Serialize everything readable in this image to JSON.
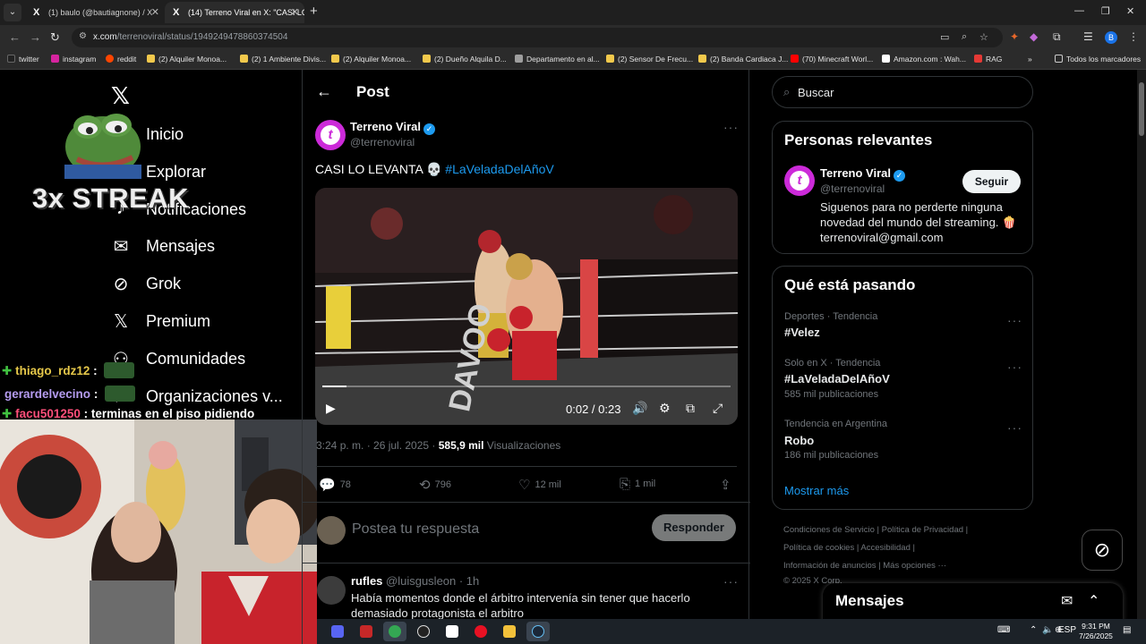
{
  "browser": {
    "tabs": [
      {
        "title": "(1) baulo (@bautiagnone) / X",
        "active": false
      },
      {
        "title": "(14) Terreno Viral en X: \"CASI LO",
        "active": true
      }
    ],
    "url_host": "x.com",
    "url_path": "/terrenoviral/status/1949249478860374504",
    "bookmarks": [
      {
        "label": "twitter",
        "color": "#000000"
      },
      {
        "label": "instagram",
        "color": "#d6249f"
      },
      {
        "label": "reddit",
        "color": "#ff4500"
      },
      {
        "label": "(2) Alquiler Monoa...",
        "color": "#f2c94c"
      },
      {
        "label": "(2) 1 Ambiente Divis...",
        "color": "#f2c94c"
      },
      {
        "label": "(2) Alquiler Monoa...",
        "color": "#f2c94c"
      },
      {
        "label": "(2) Dueño Alquila D...",
        "color": "#f2c94c"
      },
      {
        "label": "Departamento en al...",
        "color": "#9e9e9e"
      },
      {
        "label": "(2) Sensor De Frecu...",
        "color": "#f2c94c"
      },
      {
        "label": "(2) Banda Cardiaca J...",
        "color": "#f2c94c"
      },
      {
        "label": "(70) Minecraft Worl...",
        "color": "#ff0000"
      },
      {
        "label": "Amazon.com : Wah...",
        "color": "#ffffff"
      },
      {
        "label": "RAG",
        "color": "#e53935"
      }
    ],
    "all_bookmarks": "Todos los marcadores"
  },
  "nav": {
    "items": [
      {
        "label": "Inicio",
        "icon": "home-icon",
        "glyph": "⌂"
      },
      {
        "label": "Explorar",
        "icon": "search-icon",
        "glyph": "⌕"
      },
      {
        "label": "Notificaciones",
        "icon": "bell-icon",
        "glyph": "♪"
      },
      {
        "label": "Mensajes",
        "icon": "mail-icon",
        "glyph": "✉"
      },
      {
        "label": "Grok",
        "icon": "grok-icon",
        "glyph": "⊘"
      },
      {
        "label": "Premium",
        "icon": "x-premium-icon",
        "glyph": "𝕏"
      },
      {
        "label": "Comunidades",
        "icon": "communities-icon",
        "glyph": "⚇"
      },
      {
        "label": "Organizaciones v...",
        "icon": "organizations-icon",
        "glyph": "⚡"
      }
    ]
  },
  "overlay": {
    "streak": "3x STREAK",
    "chat": [
      {
        "user": "thiago_rdz12",
        "sep": ":",
        "text": "",
        "color": "#e6c84a"
      },
      {
        "user": "gerardelvecino",
        "sep": ":",
        "text": "",
        "color": "#b59cf0"
      },
      {
        "user": "facu501250",
        "sep": ":",
        "text": "terminas en el piso pidiendo",
        "color": "#ff4f7a"
      }
    ]
  },
  "post": {
    "header": "Post",
    "author": "Terreno Viral",
    "handle": "@terrenoviral",
    "text": "CASI LO LEVANTA 💀 ",
    "hashtag": "#LaVeladaDelAñoV",
    "video": {
      "time": "0:02 / 0:23",
      "progress": 0.06
    },
    "timestamp": "3:24 p. m. · 26 jul. 2025 · ",
    "views_count": "585,9 mil",
    "views_label": " Visualizaciones",
    "stats": {
      "replies": "78",
      "reposts": "796",
      "likes": "12 mil",
      "bookmarks": "1 mil"
    },
    "reply_placeholder": "Postea tu respuesta",
    "reply_button": "Responder"
  },
  "reply": {
    "name": "rufles",
    "handle_time": " @luisgusleon · 1h",
    "text": "Había momentos donde el árbitro intervenía sin tener que hacerlo demasiado protagonista el arbitro"
  },
  "sidebar": {
    "search_placeholder": "Buscar",
    "relevant": {
      "title": "Personas relevantes",
      "name": "Terreno Viral",
      "handle": "@terrenoviral",
      "follow": "Seguir",
      "bio": "Siguenos para no perderte ninguna novedad del mundo del streaming. 🍿 terrenoviral@gmail.com"
    },
    "trends": {
      "title": "Qué está pasando",
      "items": [
        {
          "context": "Deportes · Tendencia",
          "name": "#Velez",
          "count": ""
        },
        {
          "context": "Solo en X · Tendencia",
          "name": "#LaVeladaDelAñoV",
          "count": "585 mil publicaciones"
        },
        {
          "context": "Tendencia en Argentina",
          "name": "Robo",
          "count": "186 mil publicaciones"
        }
      ],
      "show_more": "Mostrar más"
    },
    "footer": {
      "line1": "Condiciones de Servicio  |  Política de Privacidad  |",
      "line2": "Política de cookies  |  Accesibilidad  |",
      "line3": "Información de anuncios  |  Más opciones ···",
      "line4": "© 2025 X Corp."
    },
    "messages": "Mensajes"
  },
  "taskbar": {
    "lang": "ESP",
    "time": "9:31 PM",
    "date": "7/26/2025"
  },
  "colors": {
    "accent": "#1d9bf0",
    "brand_avatar": "#cc2ad9",
    "background": "#000000"
  }
}
